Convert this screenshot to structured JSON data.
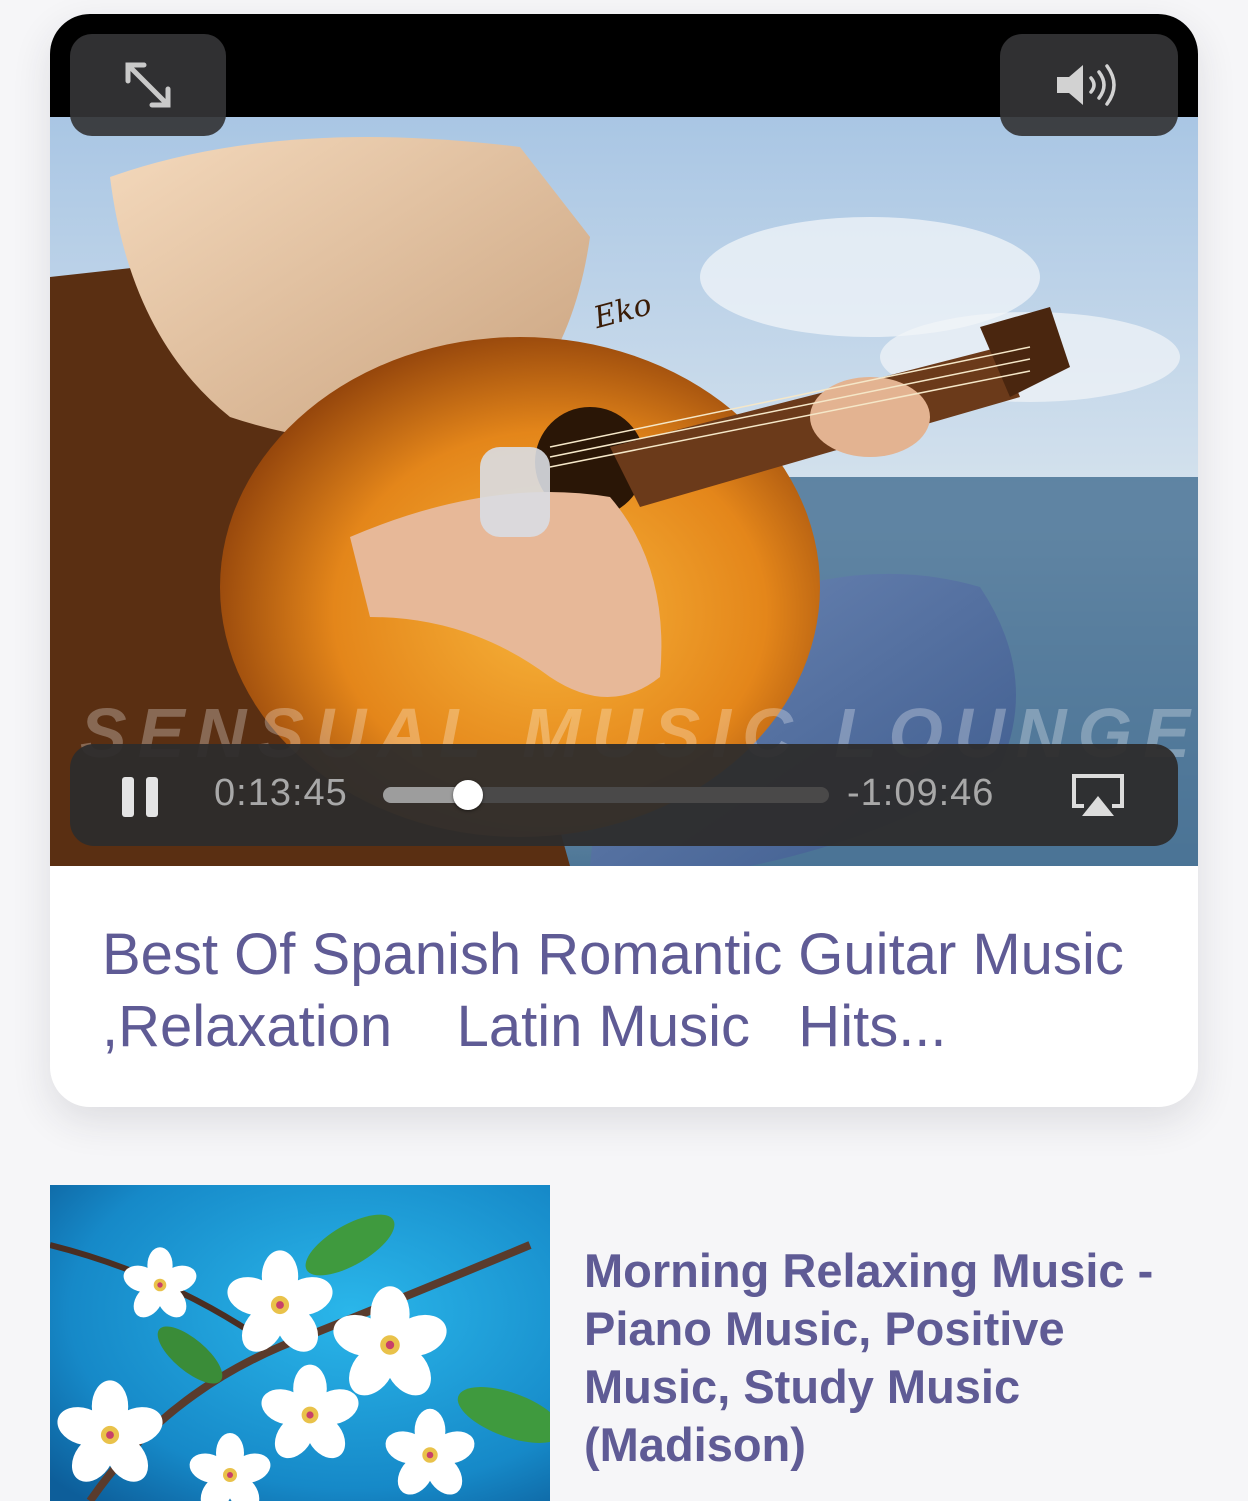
{
  "featured_video": {
    "watermark": "SENSUAL MUSIC LOUNGE",
    "guitar_brand": "Eko",
    "player": {
      "elapsed_time": "0:13:45",
      "remaining_time": "-1:09:46",
      "progress_fraction": 0.19,
      "fullscreen_icon": "fullscreen-expand-icon",
      "volume_icon": "speaker-volume-icon",
      "pause_icon": "pause-icon",
      "airplay_icon": "airplay-icon"
    },
    "title": "Best Of Spanish Romantic Guitar Music ,Relaxation    Latin Music   Hits..."
  },
  "list_items": [
    {
      "title": "Morning Relaxing Music - Piano Music, Positive Music, Study Music (Madison)"
    }
  ],
  "colors": {
    "title_text": "#5f5b95",
    "background": "#f6f6f8",
    "control_bg": "#2d2c2c"
  }
}
